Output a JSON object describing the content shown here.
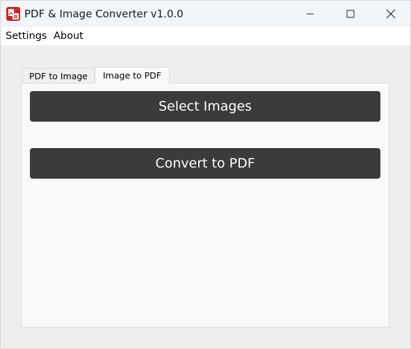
{
  "window": {
    "title": "PDF & Image Converter v1.0.0",
    "icon": "app-icon",
    "controls": {
      "minimize_icon": "minimize-icon",
      "maximize_icon": "maximize-icon",
      "close_icon": "close-icon"
    }
  },
  "menu": {
    "items": [
      {
        "label": "Settings"
      },
      {
        "label": "About"
      }
    ]
  },
  "tabs": [
    {
      "label": "PDF to Image",
      "active": false
    },
    {
      "label": "Image to PDF",
      "active": true
    }
  ],
  "actions": {
    "select_images_label": "Select Images",
    "convert_label": "Convert to PDF"
  },
  "colors": {
    "button_bg": "#3b3b3b",
    "button_text": "#ffffff",
    "titlebar_bg": "#f1f4f9",
    "app_icon_red": "#c62828"
  }
}
